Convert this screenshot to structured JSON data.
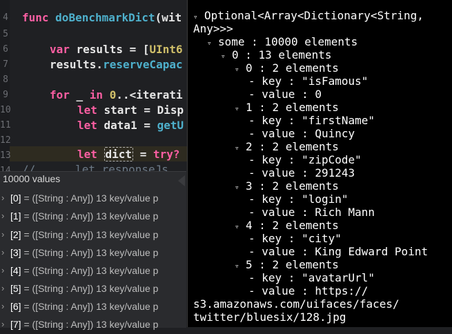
{
  "editor": {
    "line_numbers": [
      "4",
      "5",
      "6",
      "7",
      "8",
      "9",
      "10",
      "11",
      "12",
      "13",
      "14"
    ],
    "lines": {
      "l4_kw": "func ",
      "l4_fn": "doBenchmarkDict",
      "l4_rest": "(wit",
      "l6_kw": "var ",
      "l6_rest": "results = [",
      "l6_ty": "UInt6",
      "l7_rest": "results.",
      "l7_fn": "reserveCapac",
      "l9_kw": "for ",
      "l9_a": "_ ",
      "l9_kw2": "in ",
      "l9_num": "0",
      "l9_rest": "..<iterati",
      "l10_kw": "let ",
      "l10_rest": "start = Disp",
      "l11_kw": "let ",
      "l11_rest": "data1 = ",
      "l11_fn": "getU",
      "l13_kw": "let ",
      "l13_word": "dict",
      "l13_rest": " = ",
      "l13_kw2": "try?",
      "l14_cm": "//      let responseJs"
    }
  },
  "results_popover": {
    "header": "10000 values",
    "rows": [
      {
        "idx": "[0]",
        "rest": " = ([String : Any]) 13 key/value p"
      },
      {
        "idx": "[1]",
        "rest": " = ([String : Any]) 13 key/value p"
      },
      {
        "idx": "[2]",
        "rest": " = ([String : Any]) 13 key/value p"
      },
      {
        "idx": "[3]",
        "rest": " = ([String : Any]) 13 key/value p"
      },
      {
        "idx": "[4]",
        "rest": " = ([String : Any]) 13 key/value p"
      },
      {
        "idx": "[5]",
        "rest": " = ([String : Any]) 13 key/value p"
      },
      {
        "idx": "[6]",
        "rest": " = ([String : Any]) 13 key/value p"
      },
      {
        "idx": "[7]",
        "rest": " = ([String : Any]) 13 key/value p"
      }
    ]
  },
  "debug_tree": {
    "lines": [
      "Optional<Array<Dictionary<String,",
      "Any>>>",
      "some : 10000 elements",
      "0 : 13 elements",
      "0 : 2 elements",
      "- key : \"isFamous\"",
      "- value : 0",
      "1 : 2 elements",
      "- key : \"firstName\"",
      "- value : Quincy",
      "2 : 2 elements",
      "- key : \"zipCode\"",
      "- value : 291243",
      "3 : 2 elements",
      "- key : \"login\"",
      "- value : Rich Mann",
      "4 : 2 elements",
      "- key : \"city\"",
      "- value : King Edward Point",
      "5 : 2 elements",
      "- key : \"avatarUrl\"",
      "- value : https://",
      "s3.amazonaws.com/uifaces/faces/",
      "twitter/bluesix/128.jpg"
    ]
  }
}
